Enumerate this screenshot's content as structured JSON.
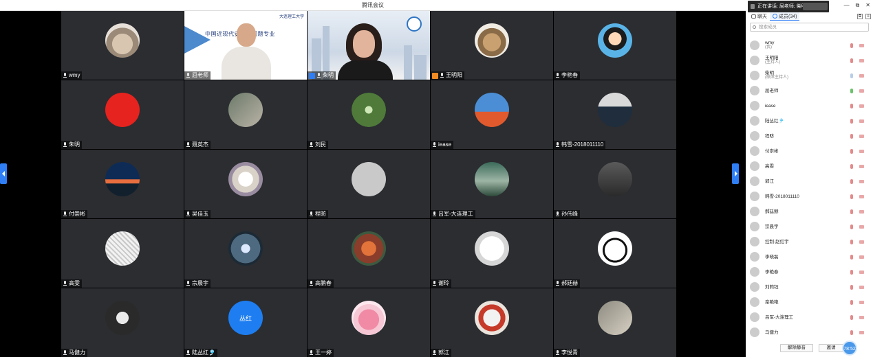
{
  "window": {
    "title": "腾讯会议",
    "controls": [
      "—",
      "⧉",
      "✕"
    ]
  },
  "speaking": {
    "text": "正在讲话: 屈老师; 柴明;"
  },
  "tabs": {
    "chat": "聊天",
    "members": "成员(34)"
  },
  "search": {
    "placeholder": "搜索成员"
  },
  "grid": [
    {
      "name": "wmy",
      "avatar": "av-cat",
      "type": "avatar"
    },
    {
      "name": "屈老师",
      "type": "video-slide",
      "slide_line": "中国近现代史纲要问题专业",
      "slide_logo": "大连理工大学"
    },
    {
      "name": "柴明",
      "type": "video-city",
      "badge": "host"
    },
    {
      "name": "王明阳",
      "avatar": "av-bowl",
      "type": "avatar",
      "badge": "cohost"
    },
    {
      "name": "李艳春",
      "avatar": "av-girl",
      "type": "avatar"
    },
    {
      "name": "朱明",
      "avatar": "av-logo-red",
      "type": "avatar"
    },
    {
      "name": "聂英杰",
      "avatar": "av-couple",
      "type": "avatar"
    },
    {
      "name": "刘民",
      "avatar": "av-trees",
      "type": "avatar"
    },
    {
      "name": "iease",
      "avatar": "av-sculpt",
      "type": "avatar"
    },
    {
      "name": "韩雪-2018011110",
      "avatar": "av-man-office",
      "type": "avatar"
    },
    {
      "name": "付崇彬",
      "avatar": "av-sunset",
      "type": "avatar"
    },
    {
      "name": "吴佳玉",
      "avatar": "av-dog",
      "type": "avatar"
    },
    {
      "name": "程昉",
      "avatar": "av-default",
      "type": "avatar"
    },
    {
      "name": "吕军-大连理工",
      "avatar": "av-deer",
      "type": "avatar"
    },
    {
      "name": "孙伟峰",
      "avatar": "av-man-dark",
      "type": "avatar"
    },
    {
      "name": "高雯",
      "avatar": "av-sketch",
      "type": "avatar"
    },
    {
      "name": "宗晨宇",
      "avatar": "av-tunnel",
      "type": "avatar"
    },
    {
      "name": "高鹏春",
      "avatar": "av-autumn",
      "type": "avatar"
    },
    {
      "name": "谢玲",
      "avatar": "av-bamboo",
      "type": "avatar"
    },
    {
      "name": "郝廷赫",
      "avatar": "av-panda",
      "type": "avatar"
    },
    {
      "name": "马健力",
      "avatar": "av-dancer",
      "type": "avatar"
    },
    {
      "name": "陆丛红🎐",
      "avatar": "av-blue",
      "type": "avatar",
      "avatar_text": "丛红"
    },
    {
      "name": "王一婷",
      "avatar": "av-bear",
      "type": "avatar"
    },
    {
      "name": "郭江",
      "avatar": "av-robot",
      "type": "avatar"
    },
    {
      "name": "李悦青",
      "avatar": "av-couple2",
      "type": "avatar"
    }
  ],
  "members": [
    {
      "name": "wmy",
      "sub": "(我)",
      "avatar": "av-cat",
      "mic": "muted"
    },
    {
      "name": "王明阳",
      "sub": "(主持人)",
      "avatar": "av-bowl",
      "mic": "muted"
    },
    {
      "name": "柴明",
      "sub": "(联席主持人)",
      "avatar": "av-chai",
      "mic": "ok"
    },
    {
      "name": "屈老师",
      "sub": "",
      "avatar": "av-host",
      "mic": "on"
    },
    {
      "name": "iease",
      "sub": "",
      "avatar": "av-sculpt",
      "mic": "muted"
    },
    {
      "name": "陆丛红🎐",
      "sub": "",
      "avatar": "av-blue",
      "mic": "muted"
    },
    {
      "name": "程昉",
      "sub": "",
      "avatar": "av-default",
      "mic": "muted"
    },
    {
      "name": "付崇彬",
      "sub": "",
      "avatar": "av-sunset",
      "mic": "muted"
    },
    {
      "name": "高雯",
      "sub": "",
      "avatar": "av-sketch",
      "mic": "muted"
    },
    {
      "name": "郭江",
      "sub": "",
      "avatar": "av-robot",
      "mic": "muted"
    },
    {
      "name": "韩雪-2018011110",
      "sub": "",
      "avatar": "av-man-office",
      "mic": "muted"
    },
    {
      "name": "郝廷赫",
      "sub": "",
      "avatar": "av-panda",
      "mic": "muted"
    },
    {
      "name": "宗晨宇",
      "sub": "",
      "avatar": "av-tunnel",
      "mic": "muted"
    },
    {
      "name": "控制-赵红宇",
      "sub": "",
      "avatar": "av-man-dark",
      "mic": "muted"
    },
    {
      "name": "李晓磊",
      "sub": "",
      "avatar": "av-trees",
      "mic": "muted"
    },
    {
      "name": "李艳春",
      "sub": "",
      "avatar": "av-girl",
      "mic": "muted"
    },
    {
      "name": "刘莉钰",
      "sub": "",
      "avatar": "av-autumn",
      "mic": "muted"
    },
    {
      "name": "栾艳艳",
      "sub": "",
      "avatar": "av-bowl",
      "mic": "muted"
    },
    {
      "name": "吕军-大连理工",
      "sub": "",
      "avatar": "av-deer",
      "mic": "muted"
    },
    {
      "name": "马健力",
      "sub": "",
      "avatar": "av-dancer",
      "mic": "muted"
    }
  ],
  "footer": {
    "unmute_all": "解除静音",
    "invite": "邀请",
    "timer": "78:52"
  }
}
